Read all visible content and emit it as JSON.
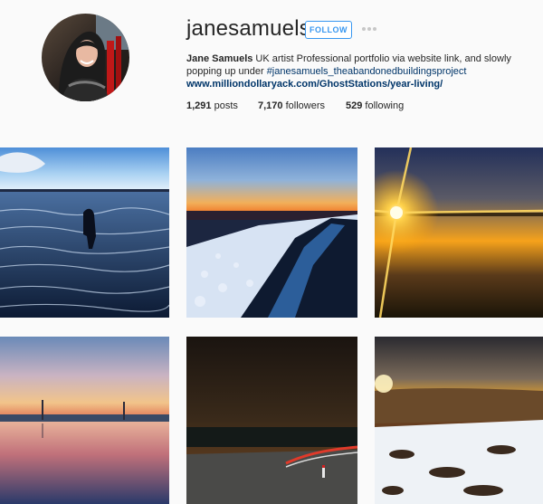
{
  "profile": {
    "username": "janesamuels",
    "follow_label": "FOLLOW",
    "more_icon": "more-dots-icon",
    "bio": {
      "name": "Jane Samuels",
      "text_before_hashtag": " UK artist Professional portfolio via website link, and slowly popping up under ",
      "hashtag": "#janesamuels_theabandonedbuildingsproject"
    },
    "website": "www.milliondollaryack.com/GhostStations/year-living/",
    "stats": {
      "posts_count": "1,291",
      "posts_label": " posts",
      "followers_count": "7,170",
      "followers_label": " followers",
      "following_count": "529",
      "following_label": " following"
    }
  },
  "colors": {
    "accent": "#3897f0",
    "link": "#003569",
    "background": "#fafafa"
  }
}
